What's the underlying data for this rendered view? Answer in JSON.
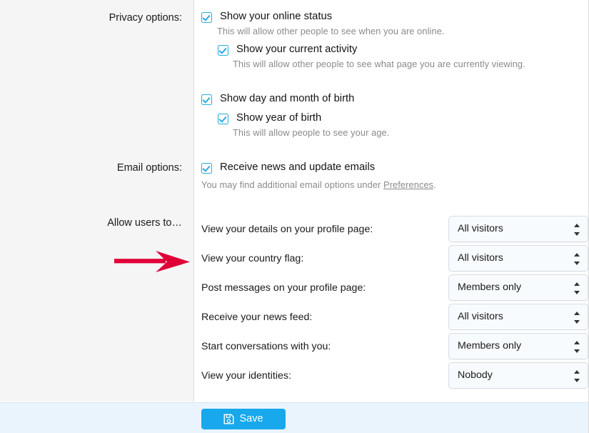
{
  "sections": {
    "privacy": {
      "gutter_label": "Privacy options:",
      "options": [
        {
          "label": "Show your online status",
          "checked": true,
          "description": "This will allow other people to see when you are online."
        },
        {
          "label": "Show your current activity",
          "checked": true,
          "description": "This will allow other people to see what page you are currently viewing."
        },
        {
          "label": "Show day and month of birth",
          "checked": true,
          "description": ""
        },
        {
          "label": "Show year of birth",
          "checked": true,
          "description": "This will allow people to see your age."
        }
      ]
    },
    "email": {
      "gutter_label": "Email options:",
      "options": [
        {
          "label": "Receive news and update emails",
          "checked": true
        }
      ],
      "note_prefix": "You may find additional email options under ",
      "note_link": "Preferences",
      "note_suffix": "."
    },
    "allow_users": {
      "gutter_label": "Allow users to…",
      "rows": [
        {
          "label": "View your details on your profile page:",
          "value": "All visitors"
        },
        {
          "label": "View your country flag:",
          "value": "All visitors"
        },
        {
          "label": "Post messages on your profile page:",
          "value": "Members only"
        },
        {
          "label": "Receive your news feed:",
          "value": "All visitors"
        },
        {
          "label": "Start conversations with you:",
          "value": "Members only"
        },
        {
          "label": "View your identities:",
          "value": "Nobody"
        }
      ]
    }
  },
  "footer": {
    "save_label": "Save",
    "save_icon": "floppy-disk-save-icon"
  },
  "annotation": {
    "arrow_icon": "red-right-arrow-icon",
    "arrow_color": "#e00038",
    "points_at": "View your country flag:"
  },
  "colors": {
    "accent": "#18a8ec",
    "checkbox": "#29abe2",
    "gutter_bg": "#f5f5f5",
    "footer_bg": "#eaf4fd",
    "border": "#dcdcdc",
    "muted_text": "#8a8a8a"
  }
}
